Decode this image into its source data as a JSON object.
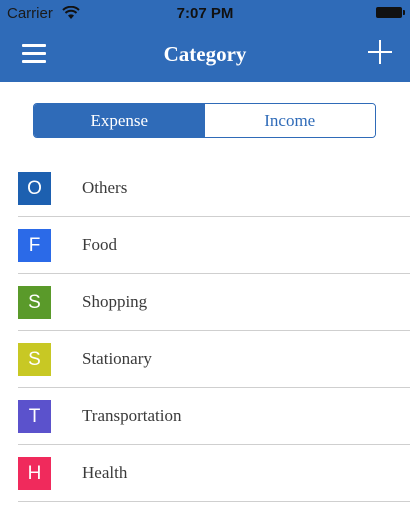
{
  "status_bar": {
    "carrier": "Carrier",
    "time": "7:07 PM"
  },
  "nav": {
    "title": "Category"
  },
  "segments": [
    {
      "label": "Expense",
      "active": true
    },
    {
      "label": "Income",
      "active": false
    }
  ],
  "categories": [
    {
      "letter": "O",
      "label": "Others",
      "color": "#1d60b0"
    },
    {
      "letter": "F",
      "label": "Food",
      "color": "#2b6ae8"
    },
    {
      "letter": "S",
      "label": "Shopping",
      "color": "#5a9a2a"
    },
    {
      "letter": "S",
      "label": "Stationary",
      "color": "#c8c824"
    },
    {
      "letter": "T",
      "label": "Transportation",
      "color": "#5b52cc"
    },
    {
      "letter": "H",
      "label": "Health",
      "color": "#f02a5c"
    }
  ]
}
